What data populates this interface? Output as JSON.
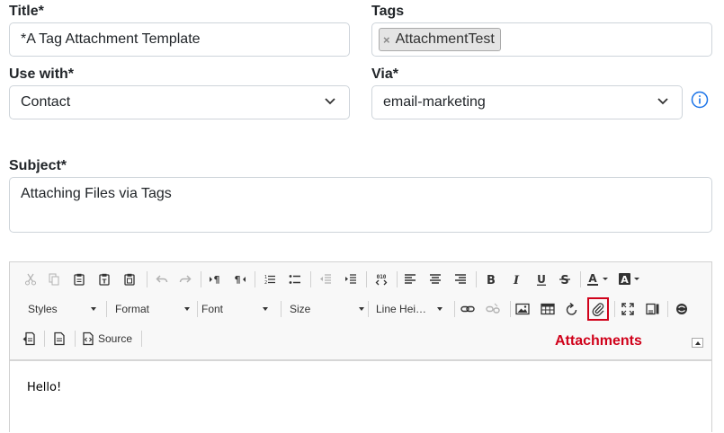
{
  "form": {
    "title": {
      "label": "Title*",
      "value": "*A Tag Attachment Template"
    },
    "tags": {
      "label": "Tags",
      "chips": [
        "AttachmentTest"
      ],
      "remove_glyph": "×"
    },
    "use_with": {
      "label": "Use with*",
      "value": "Contact"
    },
    "via": {
      "label": "Via*",
      "value": "email-marketing"
    },
    "subject": {
      "label": "Subject*",
      "value": "Attaching Files via Tags"
    }
  },
  "editor": {
    "toolbar": {
      "combos": {
        "styles": "Styles",
        "format": "Format",
        "font": "Font",
        "size": "Size",
        "line_height": "Line Hei…"
      },
      "source_label": "Source"
    },
    "annotation": "Attachments",
    "body_text": "Hello!"
  },
  "colors": {
    "accent": "#1a73e8",
    "annotation": "#d0021b"
  }
}
